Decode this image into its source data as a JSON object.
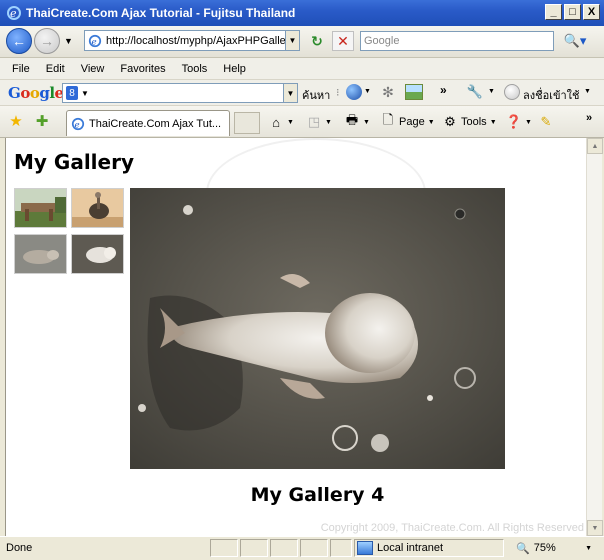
{
  "window": {
    "title": "ThaiCreate.Com Ajax Tutorial - Fujitsu Thailand",
    "minimize": "_",
    "maximize": "□",
    "close": "X"
  },
  "address_bar": {
    "back": "←",
    "forward": "→",
    "url": "http://localhost/myphp/AjaxPHPGalle",
    "search_placeholder": "Google"
  },
  "menu": {
    "items": [
      "File",
      "Edit",
      "View",
      "Favorites",
      "Tools",
      "Help"
    ]
  },
  "google_toolbar": {
    "logo": [
      "G",
      "o",
      "o",
      "g",
      "l",
      "e"
    ],
    "badge": "8",
    "search_label": "ค้นหา",
    "more": "»",
    "signin": "ลงชื่อเข้าใช้"
  },
  "tabs": {
    "active": "ThaiCreate.Com Ajax Tut...",
    "page": "Page",
    "tools": "Tools",
    "more": "»"
  },
  "page": {
    "title": "My Gallery",
    "caption": "My Gallery 4",
    "copyright": "Copyright 2009, ThaiCreate.Com. All Rights Reserved",
    "thumbnails": [
      "thumbnail-1",
      "thumbnail-2",
      "thumbnail-3",
      "thumbnail-4"
    ]
  },
  "status": {
    "text": "Done",
    "zone": "Local intranet",
    "zoom": "75%"
  }
}
